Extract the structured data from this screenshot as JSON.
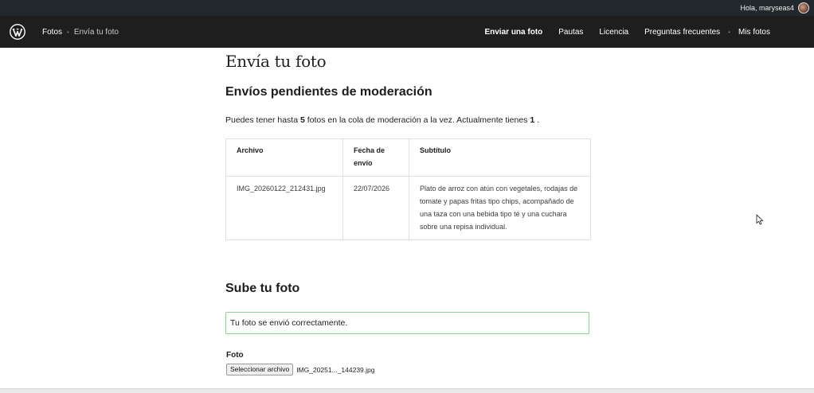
{
  "adminbar": {
    "greeting": "Hola, maryseas4"
  },
  "header": {
    "breadcrumb": {
      "root": "Fotos",
      "current": "Envía tu foto"
    },
    "nav": [
      {
        "label": "Enviar una foto",
        "active": true
      },
      {
        "label": "Pautas"
      },
      {
        "label": "Licencia"
      },
      {
        "label": "Preguntas frecuentes"
      },
      {
        "label": "Mis fotos"
      }
    ]
  },
  "main": {
    "page_title": "Envía tu foto",
    "pending": {
      "heading": "Envíos pendientes de moderación",
      "limit_prefix": "Puedes tener hasta ",
      "limit_max": "5",
      "limit_middle": " fotos en la cola de moderación a la vez. Actualmente tienes ",
      "limit_current": "1",
      "limit_suffix": " .",
      "table": {
        "headers": [
          "Archivo",
          "Fecha de envío",
          "Subtítulo"
        ],
        "rows": [
          [
            "IMG_20260122_212431.jpg",
            "22/07/2026",
            "Plato de arroz con atún con vegetales, rodajas de tomate y papas fritas tipo chips, acompañado de una taza con una bebida tipo té y una cuchara sobre una repisa individual."
          ]
        ]
      }
    },
    "upload": {
      "heading": "Sube tu foto",
      "notice": "Tu foto se envió correctamente.",
      "field_label": "Foto",
      "file_button": "Seleccionar archivo",
      "file_name": "IMG_20251..._144239.jpg"
    }
  },
  "colors": {
    "header_bg": "#1e1e1e",
    "adminbar_bg": "#23282d",
    "notice_border": "#8dd58b"
  }
}
